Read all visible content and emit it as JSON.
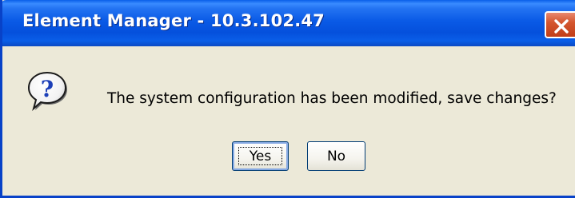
{
  "window": {
    "title": "Element Manager - 10.3.102.47",
    "close_icon": "close-icon"
  },
  "dialog": {
    "icon": "question-icon",
    "message": "The system configuration has been modified, save changes?"
  },
  "buttons": {
    "yes_label": "Yes",
    "no_label": "No",
    "default": "Yes"
  },
  "colors": {
    "titlebar": "#0a5ae6",
    "dialog_background": "#ece9d8",
    "close_button": "#d4562f"
  }
}
